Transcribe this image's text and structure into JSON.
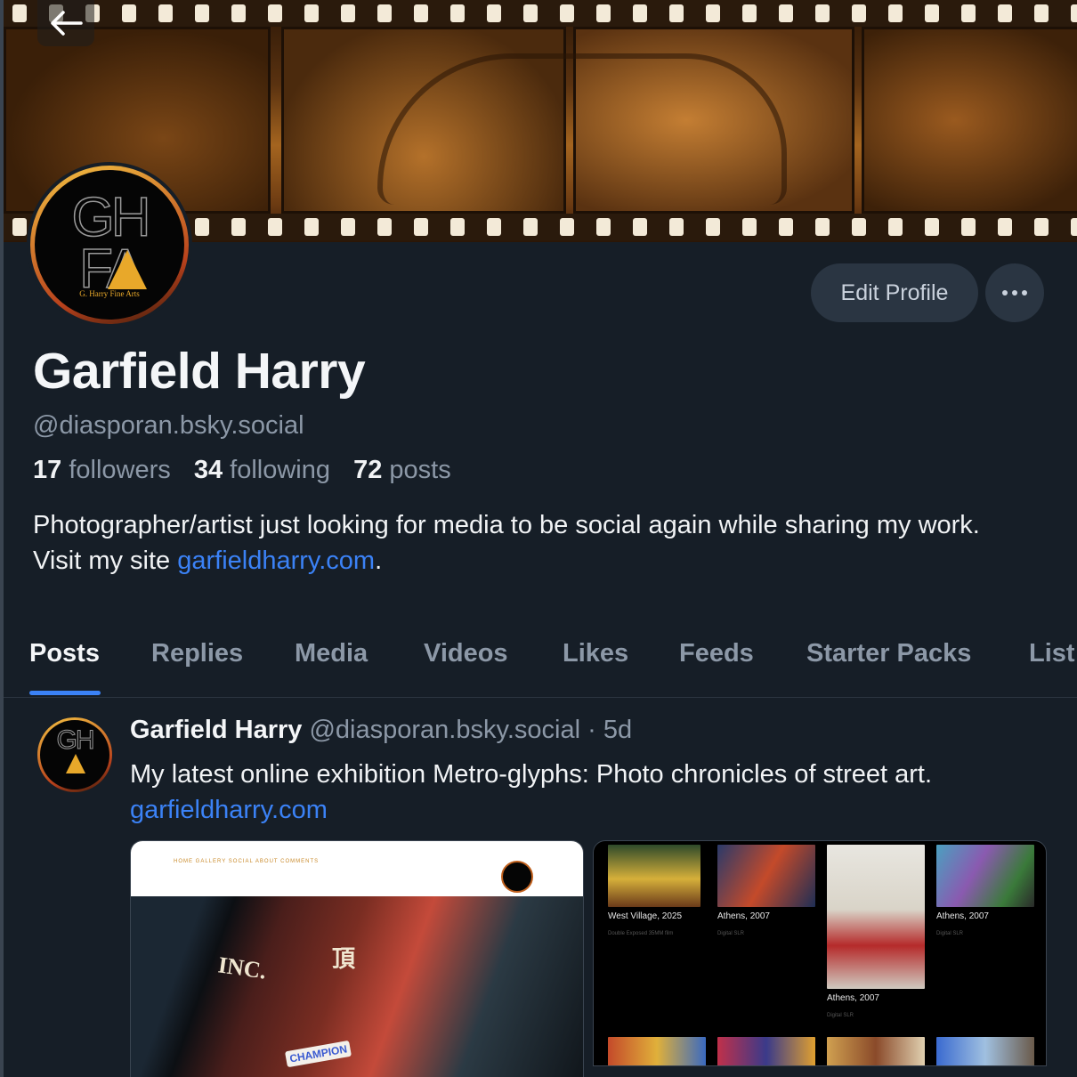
{
  "colors": {
    "background": "#161e27",
    "accent": "#3b82f6",
    "muted_text": "#8c98a7",
    "button_bg": "#2a3542"
  },
  "header": {
    "back_icon": "arrow-left-icon"
  },
  "profile": {
    "display_name": "Garfield Harry",
    "handle": "@diasporan.bsky.social",
    "avatar_logo": {
      "top_letters": "GH",
      "bottom_letters": "FA",
      "subtitle": "G. Harry Fine Arts"
    },
    "stats": {
      "followers_count": "17",
      "followers_label": "followers",
      "following_count": "34",
      "following_label": "following",
      "posts_count": "72",
      "posts_label": "posts"
    },
    "bio_text": "Photographer/artist just looking for media to be social again while sharing my work. Visit my site ",
    "bio_link": "garfieldharry.com",
    "bio_end": "."
  },
  "actions": {
    "edit_profile_label": "Edit Profile",
    "more_icon": "ellipsis-icon"
  },
  "tabs": [
    {
      "label": "Posts",
      "active": true
    },
    {
      "label": "Replies",
      "active": false
    },
    {
      "label": "Media",
      "active": false
    },
    {
      "label": "Videos",
      "active": false
    },
    {
      "label": "Likes",
      "active": false
    },
    {
      "label": "Feeds",
      "active": false
    },
    {
      "label": "Starter Packs",
      "active": false
    },
    {
      "label": "List",
      "active": false
    }
  ],
  "post": {
    "author_name": "Garfield Harry",
    "author_handle": "@diasporan.bsky.social",
    "separator": "·",
    "time_ago": "5d",
    "text": "My latest online exhibition Metro-glyphs: Photo chronicles of street art.",
    "link": "garfieldharry.com",
    "embed_left": {
      "nav_links": "HOME   GALLERY   SOCIAL   ABOUT   COMMENTS",
      "sign_text_1": "INC.",
      "sign_text_2": "頂",
      "sign_text_3": "CHAMPION"
    },
    "embed_right": {
      "items": [
        {
          "caption": "West Village, 2025",
          "sub": "Double Exposed 35MM film"
        },
        {
          "caption": "Athens, 2007",
          "sub": "Digital SLR"
        },
        {
          "caption": "Athens, 2007",
          "sub": "Digital SLR"
        },
        {
          "caption": "Athens, 2007",
          "sub": "Digital SLR"
        }
      ]
    }
  }
}
